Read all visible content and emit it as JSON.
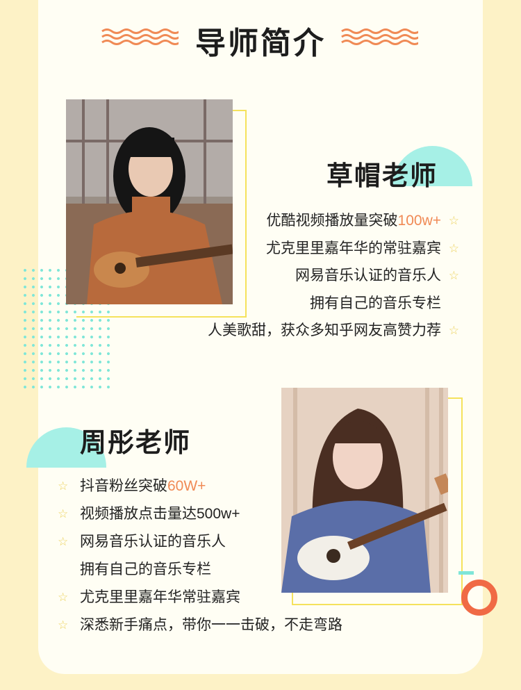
{
  "header": {
    "title": "导师简介"
  },
  "teacher1": {
    "name": "草帽老师",
    "items": [
      {
        "text": "优酷视频播放量突破",
        "highlight": "100w+",
        "star": true
      },
      {
        "text": "尤克里里嘉年华的常驻嘉宾",
        "highlight": "",
        "star": true
      },
      {
        "text": "网易音乐认证的音乐人",
        "highlight": "",
        "star": true
      },
      {
        "text": "拥有自己的音乐专栏",
        "highlight": "",
        "star": false
      },
      {
        "text": "人美歌甜，获众多知乎网友高赞力荐",
        "highlight": "",
        "star": true
      }
    ]
  },
  "teacher2": {
    "name": "周彤老师",
    "items": [
      {
        "text": "抖音粉丝突破",
        "highlight": "60W+",
        "star": true
      },
      {
        "text": "视频播放点击量达500w+",
        "highlight": "",
        "star": true
      },
      {
        "text": "网易音乐认证的音乐人",
        "highlight": "",
        "star": true
      },
      {
        "text": "拥有自己的音乐专栏",
        "highlight": "",
        "star": false
      },
      {
        "text": "尤克里里嘉年华常驻嘉宾",
        "highlight": "",
        "star": true
      },
      {
        "text": "深悉新手痛点，带你一一击破，不走弯路",
        "highlight": "",
        "star": true
      }
    ]
  },
  "colors": {
    "accent": "#f08a55",
    "mint": "#a6f0e6",
    "yellow": "#f5e25c",
    "ring": "#f06a45"
  },
  "icons": {
    "star": "star-outline-icon"
  }
}
